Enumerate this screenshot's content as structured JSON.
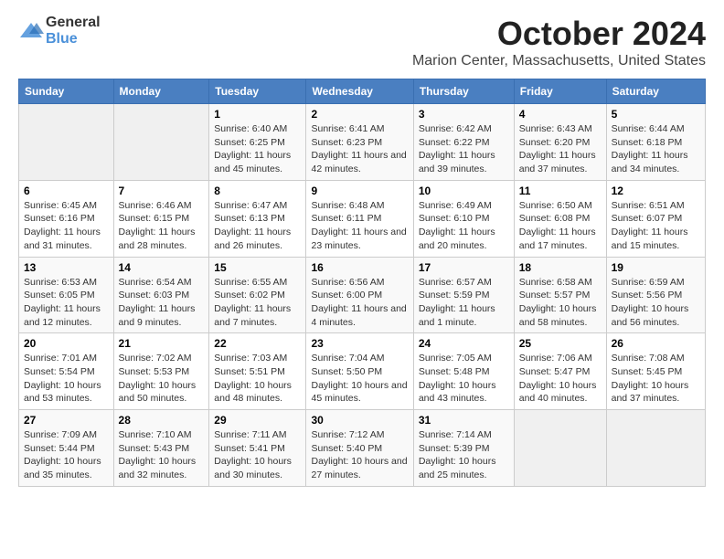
{
  "logo": {
    "general": "General",
    "blue": "Blue"
  },
  "title": "October 2024",
  "location": "Marion Center, Massachusetts, United States",
  "days_of_week": [
    "Sunday",
    "Monday",
    "Tuesday",
    "Wednesday",
    "Thursday",
    "Friday",
    "Saturday"
  ],
  "weeks": [
    [
      {
        "day": "",
        "sunrise": "",
        "sunset": "",
        "daylight": ""
      },
      {
        "day": "",
        "sunrise": "",
        "sunset": "",
        "daylight": ""
      },
      {
        "day": "1",
        "sunrise": "Sunrise: 6:40 AM",
        "sunset": "Sunset: 6:25 PM",
        "daylight": "Daylight: 11 hours and 45 minutes."
      },
      {
        "day": "2",
        "sunrise": "Sunrise: 6:41 AM",
        "sunset": "Sunset: 6:23 PM",
        "daylight": "Daylight: 11 hours and 42 minutes."
      },
      {
        "day": "3",
        "sunrise": "Sunrise: 6:42 AM",
        "sunset": "Sunset: 6:22 PM",
        "daylight": "Daylight: 11 hours and 39 minutes."
      },
      {
        "day": "4",
        "sunrise": "Sunrise: 6:43 AM",
        "sunset": "Sunset: 6:20 PM",
        "daylight": "Daylight: 11 hours and 37 minutes."
      },
      {
        "day": "5",
        "sunrise": "Sunrise: 6:44 AM",
        "sunset": "Sunset: 6:18 PM",
        "daylight": "Daylight: 11 hours and 34 minutes."
      }
    ],
    [
      {
        "day": "6",
        "sunrise": "Sunrise: 6:45 AM",
        "sunset": "Sunset: 6:16 PM",
        "daylight": "Daylight: 11 hours and 31 minutes."
      },
      {
        "day": "7",
        "sunrise": "Sunrise: 6:46 AM",
        "sunset": "Sunset: 6:15 PM",
        "daylight": "Daylight: 11 hours and 28 minutes."
      },
      {
        "day": "8",
        "sunrise": "Sunrise: 6:47 AM",
        "sunset": "Sunset: 6:13 PM",
        "daylight": "Daylight: 11 hours and 26 minutes."
      },
      {
        "day": "9",
        "sunrise": "Sunrise: 6:48 AM",
        "sunset": "Sunset: 6:11 PM",
        "daylight": "Daylight: 11 hours and 23 minutes."
      },
      {
        "day": "10",
        "sunrise": "Sunrise: 6:49 AM",
        "sunset": "Sunset: 6:10 PM",
        "daylight": "Daylight: 11 hours and 20 minutes."
      },
      {
        "day": "11",
        "sunrise": "Sunrise: 6:50 AM",
        "sunset": "Sunset: 6:08 PM",
        "daylight": "Daylight: 11 hours and 17 minutes."
      },
      {
        "day": "12",
        "sunrise": "Sunrise: 6:51 AM",
        "sunset": "Sunset: 6:07 PM",
        "daylight": "Daylight: 11 hours and 15 minutes."
      }
    ],
    [
      {
        "day": "13",
        "sunrise": "Sunrise: 6:53 AM",
        "sunset": "Sunset: 6:05 PM",
        "daylight": "Daylight: 11 hours and 12 minutes."
      },
      {
        "day": "14",
        "sunrise": "Sunrise: 6:54 AM",
        "sunset": "Sunset: 6:03 PM",
        "daylight": "Daylight: 11 hours and 9 minutes."
      },
      {
        "day": "15",
        "sunrise": "Sunrise: 6:55 AM",
        "sunset": "Sunset: 6:02 PM",
        "daylight": "Daylight: 11 hours and 7 minutes."
      },
      {
        "day": "16",
        "sunrise": "Sunrise: 6:56 AM",
        "sunset": "Sunset: 6:00 PM",
        "daylight": "Daylight: 11 hours and 4 minutes."
      },
      {
        "day": "17",
        "sunrise": "Sunrise: 6:57 AM",
        "sunset": "Sunset: 5:59 PM",
        "daylight": "Daylight: 11 hours and 1 minute."
      },
      {
        "day": "18",
        "sunrise": "Sunrise: 6:58 AM",
        "sunset": "Sunset: 5:57 PM",
        "daylight": "Daylight: 10 hours and 58 minutes."
      },
      {
        "day": "19",
        "sunrise": "Sunrise: 6:59 AM",
        "sunset": "Sunset: 5:56 PM",
        "daylight": "Daylight: 10 hours and 56 minutes."
      }
    ],
    [
      {
        "day": "20",
        "sunrise": "Sunrise: 7:01 AM",
        "sunset": "Sunset: 5:54 PM",
        "daylight": "Daylight: 10 hours and 53 minutes."
      },
      {
        "day": "21",
        "sunrise": "Sunrise: 7:02 AM",
        "sunset": "Sunset: 5:53 PM",
        "daylight": "Daylight: 10 hours and 50 minutes."
      },
      {
        "day": "22",
        "sunrise": "Sunrise: 7:03 AM",
        "sunset": "Sunset: 5:51 PM",
        "daylight": "Daylight: 10 hours and 48 minutes."
      },
      {
        "day": "23",
        "sunrise": "Sunrise: 7:04 AM",
        "sunset": "Sunset: 5:50 PM",
        "daylight": "Daylight: 10 hours and 45 minutes."
      },
      {
        "day": "24",
        "sunrise": "Sunrise: 7:05 AM",
        "sunset": "Sunset: 5:48 PM",
        "daylight": "Daylight: 10 hours and 43 minutes."
      },
      {
        "day": "25",
        "sunrise": "Sunrise: 7:06 AM",
        "sunset": "Sunset: 5:47 PM",
        "daylight": "Daylight: 10 hours and 40 minutes."
      },
      {
        "day": "26",
        "sunrise": "Sunrise: 7:08 AM",
        "sunset": "Sunset: 5:45 PM",
        "daylight": "Daylight: 10 hours and 37 minutes."
      }
    ],
    [
      {
        "day": "27",
        "sunrise": "Sunrise: 7:09 AM",
        "sunset": "Sunset: 5:44 PM",
        "daylight": "Daylight: 10 hours and 35 minutes."
      },
      {
        "day": "28",
        "sunrise": "Sunrise: 7:10 AM",
        "sunset": "Sunset: 5:43 PM",
        "daylight": "Daylight: 10 hours and 32 minutes."
      },
      {
        "day": "29",
        "sunrise": "Sunrise: 7:11 AM",
        "sunset": "Sunset: 5:41 PM",
        "daylight": "Daylight: 10 hours and 30 minutes."
      },
      {
        "day": "30",
        "sunrise": "Sunrise: 7:12 AM",
        "sunset": "Sunset: 5:40 PM",
        "daylight": "Daylight: 10 hours and 27 minutes."
      },
      {
        "day": "31",
        "sunrise": "Sunrise: 7:14 AM",
        "sunset": "Sunset: 5:39 PM",
        "daylight": "Daylight: 10 hours and 25 minutes."
      },
      {
        "day": "",
        "sunrise": "",
        "sunset": "",
        "daylight": ""
      },
      {
        "day": "",
        "sunrise": "",
        "sunset": "",
        "daylight": ""
      }
    ]
  ]
}
